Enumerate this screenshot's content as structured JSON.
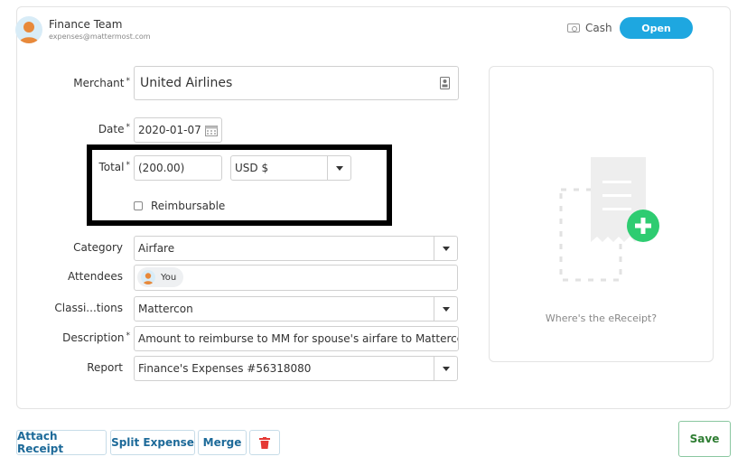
{
  "header": {
    "name": "Finance Team",
    "email": "expenses@mattermost.com",
    "payment_type": "Cash",
    "status": "Open"
  },
  "form": {
    "merchant": {
      "label": "Merchant",
      "value": "United Airlines"
    },
    "date": {
      "label": "Date",
      "value": "2020-01-07"
    },
    "total": {
      "label": "Total",
      "value": "(200.00)",
      "currency": "USD $"
    },
    "reimbursable": {
      "label": "Reimbursable",
      "checked": false
    },
    "category": {
      "label": "Category",
      "value": "Airfare"
    },
    "attendees": {
      "label": "Attendees",
      "value": "You"
    },
    "classifications": {
      "label": "Classi...tions",
      "value": "Mattercon"
    },
    "description": {
      "label": "Description",
      "value": "Amount to reimburse to MM for spouse's airfare to Mattercon"
    },
    "report": {
      "label": "Report",
      "value": "Finance's Expenses #56318080"
    }
  },
  "receipt": {
    "prompt": "Where's the eReceipt?"
  },
  "actions": {
    "attach": "Attach Receipt",
    "split": "Split Expense",
    "merge": "Merge",
    "save": "Save"
  },
  "colors": {
    "accent": "#1ea7e0",
    "link": "#1d6a99",
    "save_green": "#2e7d32",
    "add_green": "#2ecc71",
    "delete_red": "#e53935"
  },
  "required_marker": "*",
  "icons": [
    "cash-icon",
    "contact-card-icon",
    "calendar-icon",
    "receipt-placeholder-icon",
    "add-icon",
    "trash-icon",
    "user-avatar-icon"
  ]
}
